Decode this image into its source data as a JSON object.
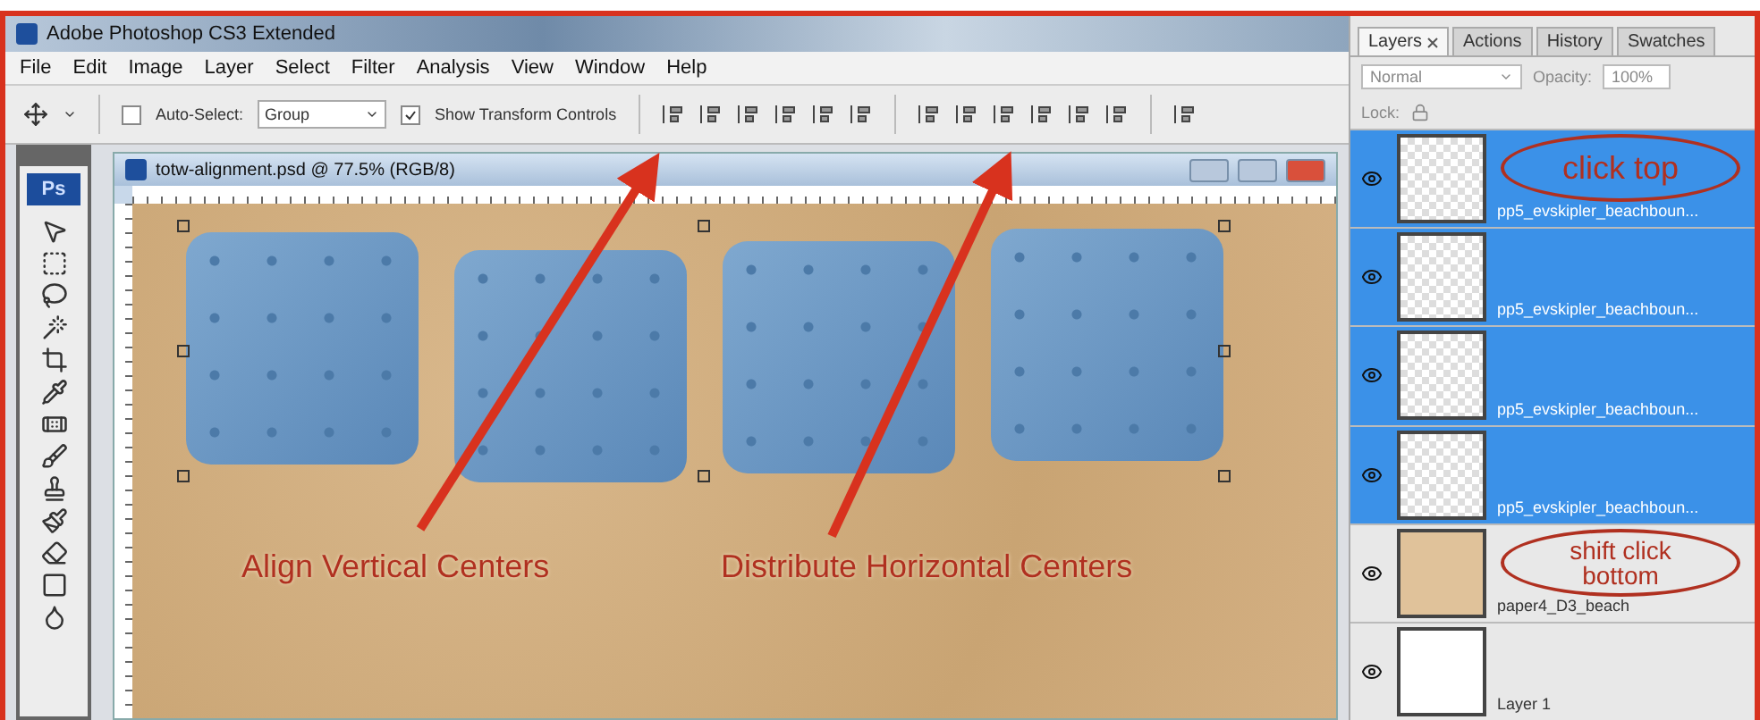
{
  "window": {
    "title": "Adobe Photoshop CS3 Extended"
  },
  "menu": [
    "File",
    "Edit",
    "Image",
    "Layer",
    "Select",
    "Filter",
    "Analysis",
    "View",
    "Window",
    "Help"
  ],
  "options_bar": {
    "auto_select": {
      "label": "Auto-Select:",
      "checked": false
    },
    "group_dropdown": "Group",
    "show_transform": {
      "label": "Show Transform Controls",
      "checked": true
    }
  },
  "toolbox": {
    "logo": "Ps"
  },
  "document": {
    "title": "totw-alignment.psd @ 77.5% (RGB/8)"
  },
  "panel": {
    "tabs": [
      {
        "label": "Layers",
        "selected": true,
        "closable": true
      },
      {
        "label": "Actions",
        "selected": false,
        "closable": false
      },
      {
        "label": "History",
        "selected": false,
        "closable": false
      },
      {
        "label": "Swatches",
        "selected": false,
        "closable": false
      }
    ],
    "blend_mode": "Normal",
    "opacity_label": "Opacity:",
    "opacity": "100%",
    "lock_label": "Lock:",
    "layers": [
      {
        "name": "pp5_evskipler_beachboun...",
        "selected": true,
        "kind": "transparent"
      },
      {
        "name": "pp5_evskipler_beachboun...",
        "selected": true,
        "kind": "transparent"
      },
      {
        "name": "pp5_evskipler_beachboun...",
        "selected": true,
        "kind": "transparent"
      },
      {
        "name": "pp5_evskipler_beachboun...",
        "selected": true,
        "kind": "transparent"
      },
      {
        "name": "paper4_D3_beach",
        "selected": false,
        "kind": "paper"
      },
      {
        "name": "Layer 1",
        "selected": false,
        "kind": "white"
      }
    ]
  },
  "annotations": [
    {
      "kind": "label",
      "text": "Align Vertical Centers"
    },
    {
      "kind": "label",
      "text": "Distribute Horizontal Centers"
    },
    {
      "kind": "ellipse",
      "text": "click top"
    },
    {
      "kind": "ellipse",
      "text": "shift click bottom"
    }
  ]
}
